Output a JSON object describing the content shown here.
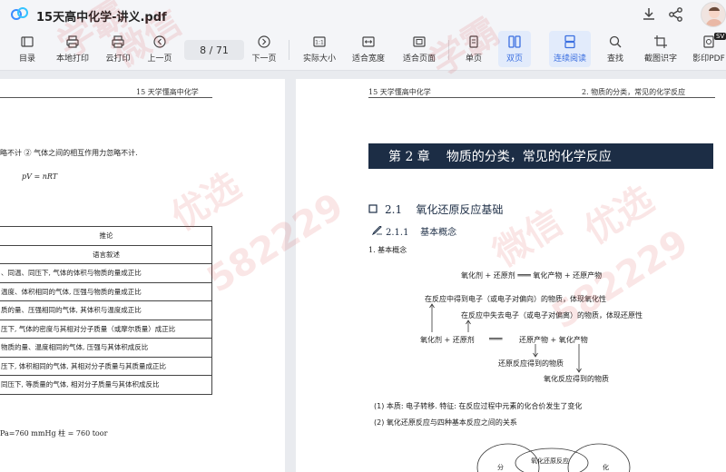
{
  "window": {
    "title": "15天高中化学-讲义.pdf"
  },
  "toolbar": {
    "items": [
      {
        "label": "目录",
        "icon": "toc-icon"
      },
      {
        "label": "本地打印",
        "icon": "printer-icon"
      },
      {
        "label": "云打印",
        "icon": "cloud-print-icon"
      },
      {
        "label": "上一页",
        "icon": "prev-page-icon"
      },
      {
        "label": "下一页",
        "icon": "next-page-icon"
      },
      {
        "label": "实际大小",
        "icon": "actual-size-icon"
      },
      {
        "label": "适合宽度",
        "icon": "fit-width-icon"
      },
      {
        "label": "适合页面",
        "icon": "fit-page-icon"
      },
      {
        "label": "单页",
        "icon": "single-page-icon"
      },
      {
        "label": "双页",
        "icon": "double-page-icon"
      },
      {
        "label": "连续阅读",
        "icon": "continuous-read-icon"
      },
      {
        "label": "查找",
        "icon": "search-icon"
      },
      {
        "label": "截图识字",
        "icon": "screenshot-ocr-icon"
      },
      {
        "label": "影印PDF",
        "icon": "scan-pdf-icon"
      }
    ],
    "page_indicator": "8  /  71",
    "active": [
      "双页",
      "连续阅读"
    ],
    "badge": "SV",
    "accent": "#3b6fe0"
  },
  "left_page": {
    "running_head": "15 天学懂高中化学",
    "line1": "略不计 ② 气体之间的相互作用力忽略不计.",
    "formula": "pV = nRT",
    "table_header": "推论",
    "table_subheader": "语言叙述",
    "rows": [
      "、同温、同压下, 气体的体积与物质的量成正比",
      "温度、体积相同的气体, 压强与物质的量成正比",
      "质的量、压强相同的气体, 其体积与温度成正比",
      "压下, 气体的密度与其相对分子质量（或摩尔质量）成正比",
      "物质的量、温度相同的气体, 压强与其体积成反比",
      "压下, 体积相同的气体, 其相对分子质量与其质量成正比",
      "同压下, 等质量的气体, 相对分子质量与其体积成反比"
    ],
    "footer_line": "Pa=760 mmHg 柱 = 760 toor"
  },
  "right_page": {
    "running_head_left": "15 天学懂高中化学",
    "running_head_right": "2.   物质的分类，常见的化学反应",
    "chapter_number": "第 2 章",
    "chapter_title": "物质的分类，常见的化学反应",
    "section_number": "2.1",
    "section_title": "氧化还原反应基础",
    "subsection_number": "2.1.1",
    "subsection_title": "基本概念",
    "item1": "1. 基本概念",
    "equation": "氧化剂 + 还原剂 ═══ 氧化产物 + 还原产物",
    "note_gain": "在反应中得到电子（或电子对偏向）的物质，体现氧化性",
    "note_lose": "在反应中失去电子（或电子对偏离）的物质，体现还原性",
    "eq2_left1": "氧化剂 + 还原剂",
    "eq2_sign": "═══",
    "eq2_right": "还原产物 + 氧化产物",
    "note_reduced": "还原反应得到的物质",
    "note_oxidized": "氧化反应得到的物质",
    "point1": "(1)  本质: 电子转移. 特征: 在反应过程中元素的化合价发生了变化",
    "point2": "(2)  氧化还原反应与四种基本反应之间的关系",
    "venn_label": "氧化还原反应",
    "venn_left": "分",
    "venn_right": "化"
  },
  "watermarks": [
    "学霸",
    "微信",
    "优选",
    "582229",
    "学霸",
    "微信",
    "优选",
    "582229"
  ]
}
